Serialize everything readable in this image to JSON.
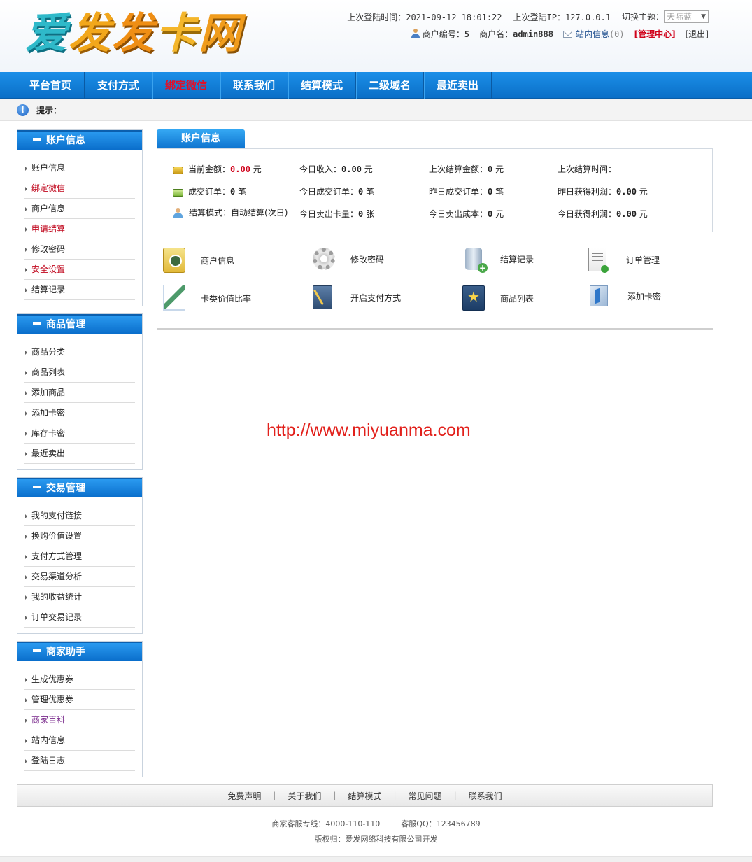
{
  "header": {
    "logo_chars": [
      "爱",
      "发",
      "发",
      "卡",
      "网"
    ],
    "last_login_time_label": "上次登陆时间：",
    "last_login_time": "2021-09-12 18:01:22",
    "last_login_ip_label": "上次登陆IP：",
    "last_login_ip": "127.0.0.1",
    "theme_label": "切换主题：",
    "theme_value": "天际蓝",
    "merchant_no_label": "商户编号：",
    "merchant_no": "5",
    "merchant_name_label": "商户名：",
    "merchant_name": "admin888",
    "messages_label": "站内信息",
    "messages_count": "(0)",
    "admin_center": "[管理中心]",
    "logout": "[退出]"
  },
  "nav": {
    "items": [
      "平台首页",
      "支付方式",
      "绑定微信",
      "联系我们",
      "结算模式",
      "二级域名",
      "最近卖出"
    ],
    "active_index": 2
  },
  "tip": {
    "label": "提示："
  },
  "sidebar": {
    "sections": [
      {
        "title": "账户信息",
        "items": [
          "账户信息",
          "绑定微信",
          "商户信息",
          "申请结算",
          "修改密码",
          "安全设置",
          "结算记录"
        ]
      },
      {
        "title": "商品管理",
        "items": [
          "商品分类",
          "商品列表",
          "添加商品",
          "添加卡密",
          "库存卡密",
          "最近卖出"
        ]
      },
      {
        "title": "交易管理",
        "items": [
          "我的支付链接",
          "换购价值设置",
          "支付方式管理",
          "交易渠道分析",
          "我的收益统计",
          "订单交易记录"
        ]
      },
      {
        "title": "商家助手",
        "items": [
          "生成优惠券",
          "管理优惠券",
          "商家百科",
          "站内信息",
          "登陆日志"
        ]
      }
    ]
  },
  "account": {
    "tab_title": "账户信息",
    "current_balance_label": "当前金额：",
    "current_balance": "0.00",
    "yuan": "元",
    "today_income_label": "今日收入：",
    "today_income": "0.00",
    "last_settle_amount_label": "上次结算金额：",
    "last_settle_amount": "0",
    "last_settle_time_label": "上次结算时间：",
    "orders_label": "成交订单：",
    "orders": "0",
    "bi": "笔",
    "today_orders_label": "今日成交订单：",
    "today_orders": "0",
    "yesterday_orders_label": "昨日成交订单：",
    "yesterday_orders": "0",
    "yesterday_profit_label": "昨日获得利润：",
    "yesterday_profit": "0.00",
    "settle_mode_label": "结算模式：",
    "settle_mode": "自动结算(次日)",
    "today_cards_label": "今日卖出卡量：",
    "today_cards": "0",
    "zhang": "张",
    "today_cost_label": "今日卖出成本：",
    "today_cost": "0",
    "today_profit_label": "今日获得利润：",
    "today_profit": "0.00"
  },
  "shortcuts": [
    "商户信息",
    "修改密码",
    "结算记录",
    "订单管理",
    "卡类价值比率",
    "开启支付方式",
    "商品列表",
    "添加卡密"
  ],
  "watermark": "http://www.miyuanma.com",
  "footer": {
    "links": [
      "免费声明",
      "关于我们",
      "结算模式",
      "常见问题",
      "联系我们"
    ],
    "separator": "|",
    "hotline_label": "商家客服专线：",
    "hotline": "4000-110-110",
    "qq_label": "客服QQ：",
    "qq": "123456789",
    "copyright": "版权归：爱发网络科技有限公司开发"
  },
  "colors": {
    "nav_blue": "#0b6fc7",
    "nav_active": "#e0102a",
    "accent_red": "#d0021b"
  }
}
